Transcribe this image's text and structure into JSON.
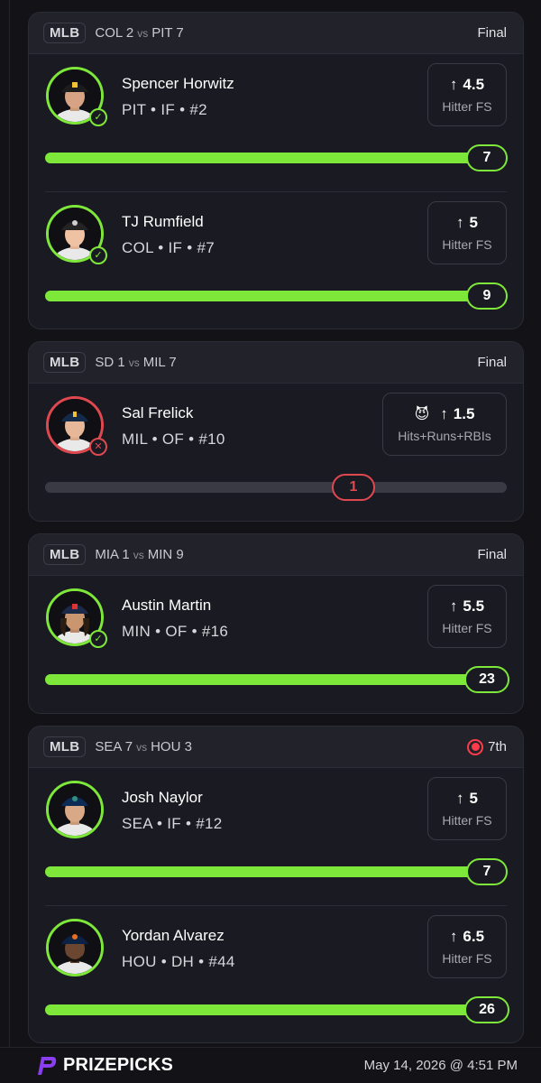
{
  "colors": {
    "win": "#7ee83a",
    "loss": "#e04850",
    "live": "#ff3b4a",
    "bg": "#121217"
  },
  "games": [
    {
      "league": "MLB",
      "team1": "COL 2",
      "vs": "vs",
      "team2": "PIT 7",
      "status": "Final",
      "live": false,
      "picks": [
        {
          "name": "Spencer Horwitz",
          "meta": "PIT • IF • #2",
          "line": "4.5",
          "stat": "Hitter FS",
          "actual": "7",
          "result": "win",
          "progress": 1.0,
          "icon": "pirates-cap"
        },
        {
          "name": "TJ Rumfield",
          "meta": "COL • IF • #7",
          "line": "5",
          "stat": "Hitter FS",
          "actual": "9",
          "result": "win",
          "progress": 1.0,
          "icon": "rockies-cap"
        }
      ]
    },
    {
      "league": "MLB",
      "team1": "SD 1",
      "vs": "vs",
      "team2": "MIL 7",
      "status": "Final",
      "live": false,
      "picks": [
        {
          "name": "Sal Frelick",
          "meta": "MIL • OF • #10",
          "line": "1.5",
          "stat": "Hits+Runs+RBIs",
          "actual": "1",
          "result": "loss",
          "progress": 0.67,
          "demon": true,
          "icon": "brewers-cap"
        }
      ]
    },
    {
      "league": "MLB",
      "team1": "MIA 1",
      "vs": "vs",
      "team2": "MIN 9",
      "status": "Final",
      "live": false,
      "picks": [
        {
          "name": "Austin Martin",
          "meta": "MIN • OF • #16",
          "line": "5.5",
          "stat": "Hitter FS",
          "actual": "23",
          "result": "win",
          "progress": 1.0,
          "icon": "twins-cap"
        }
      ]
    },
    {
      "league": "MLB",
      "team1": "SEA 7",
      "vs": "vs",
      "team2": "HOU 3",
      "status": "7th",
      "live": true,
      "picks": [
        {
          "name": "Josh Naylor",
          "meta": "SEA • IF • #12",
          "line": "5",
          "stat": "Hitter FS",
          "actual": "7",
          "result": "live-over",
          "progress": 1.0,
          "icon": "mariners-cap"
        },
        {
          "name": "Yordan Alvarez",
          "meta": "HOU • DH • #44",
          "line": "6.5",
          "stat": "Hitter FS",
          "actual": "26",
          "result": "live-over",
          "progress": 1.0,
          "icon": "astros-cap"
        }
      ]
    }
  ],
  "footer": {
    "brand": "PRIZEPICKS",
    "timestamp": "May 14, 2026 @ 4:51 PM"
  }
}
